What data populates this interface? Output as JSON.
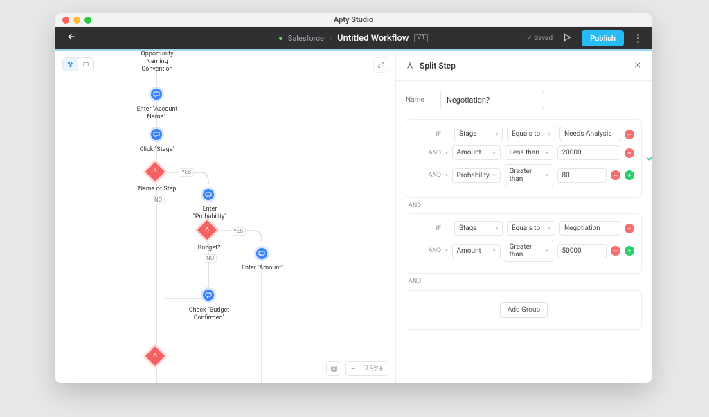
{
  "titlebar": {
    "app_title": "Apty Studio"
  },
  "toolbar": {
    "breadcrumb_app": "Salesforce",
    "workflow_title": "Untitled Workflow",
    "version_badge": "V1",
    "saved_label": "Saved",
    "publish_label": "Publish"
  },
  "canvas": {
    "zoom_pct": "75%",
    "nodes": {
      "n0": "Opportunity Naming Convention",
      "n1": "Enter \"Account Name\".",
      "n2": "Click \"Stage\"",
      "split1": "Name of Step",
      "split1_yes": "YES",
      "split1_no": "NO",
      "n3": "Enter \"Probability\"",
      "split2": "Budget?",
      "split2_yes": "YES",
      "split2_no": "NO",
      "n4": "Enter \"Amount\"",
      "n5": "Check \"Budget Confirmed\""
    }
  },
  "panel": {
    "title": "Split Step",
    "name_label": "Name",
    "name_value": "Negotiation?",
    "group1": {
      "rows": [
        {
          "op": "IF",
          "field": "Stage",
          "cmp": "Equals to",
          "val": "Needs Analysis"
        },
        {
          "op": "AND",
          "field": "Amount",
          "cmp": "Less than",
          "val": "20000"
        },
        {
          "op": "AND",
          "field": "Probability",
          "cmp": "Greater than",
          "val": "80"
        }
      ]
    },
    "sep1": "AND",
    "group2": {
      "rows": [
        {
          "op": "IF",
          "field": "Stage",
          "cmp": "Equals to",
          "val": "Negotiation"
        },
        {
          "op": "AND",
          "field": "Amount",
          "cmp": "Greater than",
          "val": "50000"
        }
      ]
    },
    "sep2": "AND",
    "add_group_label": "Add Group"
  }
}
